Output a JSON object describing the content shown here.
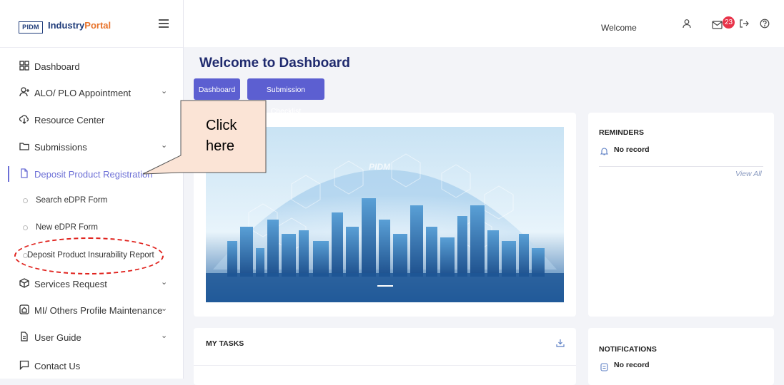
{
  "brand": {
    "logo": "PIDM",
    "name_part1": "Industry",
    "name_part2": "Portal"
  },
  "sidebar": {
    "items": [
      {
        "label": "Dashboard"
      },
      {
        "label": "ALO/ PLO Appointment"
      },
      {
        "label": "Resource Center"
      },
      {
        "label": "Submissions"
      },
      {
        "label": "Deposit Product Registration"
      },
      {
        "label": "Services Request"
      },
      {
        "label": "MI/ Others Profile Maintenance"
      },
      {
        "label": "User Guide"
      },
      {
        "label": "Contact Us"
      }
    ],
    "sub_items": [
      {
        "label": "Search eDPR Form"
      },
      {
        "label": "New eDPR Form"
      },
      {
        "label": "Deposit Product Insurability Report"
      }
    ]
  },
  "topbar": {
    "welcome": "Welcome",
    "notification_count": "23"
  },
  "main": {
    "title": "Welcome to Dashboard",
    "buttons": {
      "dashboard": "Dashboard",
      "checklist": "Submission Checklist"
    },
    "banner_watermark": "PIDM",
    "reminders": {
      "title": "REMINDERS",
      "empty": "No record",
      "view_all": "View All"
    },
    "my_tasks": {
      "title": "MY TASKS"
    },
    "notifications": {
      "title": "NOTIFICATIONS",
      "empty": "No record"
    }
  },
  "annotation": {
    "callout_line1": "Click",
    "callout_line2": "here"
  },
  "colors": {
    "accent": "#5c5fd1",
    "active_nav": "#6c6fd6",
    "badge": "#e8344a",
    "callout_fill": "#fbe4d6",
    "highlight_ellipse": "#e0231e",
    "title": "#1f2a6e"
  }
}
